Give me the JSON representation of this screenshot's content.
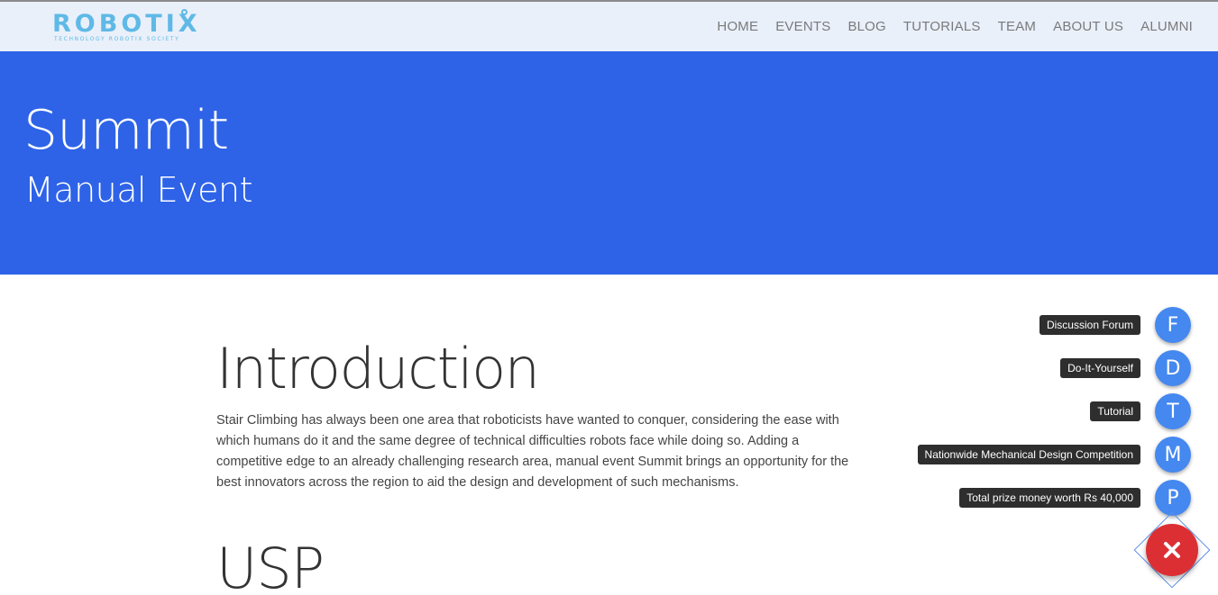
{
  "brand": {
    "logo_text": "ROBOTIX",
    "logo_tagline": "TECHNOLOGY ROBOTIX SOCIETY"
  },
  "nav": {
    "items": [
      {
        "label": "HOME"
      },
      {
        "label": "EVENTS"
      },
      {
        "label": "BLOG"
      },
      {
        "label": "TUTORIALS"
      },
      {
        "label": "TEAM"
      },
      {
        "label": "ABOUT US"
      },
      {
        "label": "ALUMNI"
      }
    ]
  },
  "hero": {
    "title": "Summit",
    "subtitle": "Manual Event"
  },
  "content": {
    "intro_heading": "Introduction",
    "intro_text": "Stair Climbing has always been one area that roboticists have wanted to conquer, considering the ease with which humans do it and the same degree of technical difficulties robots face while doing so. Adding a competitive edge to an already challenging research area, manual event Summit brings an opportunity for the best innovators across the region to aid the design and development of such mechanisms.",
    "usp_heading": "USP"
  },
  "fab_menu": {
    "items": [
      {
        "letter": "F",
        "label": "Discussion Forum"
      },
      {
        "letter": "D",
        "label": "Do-It-Yourself"
      },
      {
        "letter": "T",
        "label": "Tutorial"
      },
      {
        "letter": "M",
        "label": "Nationwide Mechanical Design Competition"
      },
      {
        "letter": "P",
        "label": "Total prize money worth Rs 40,000"
      }
    ],
    "close_icon": "close-icon"
  },
  "colors": {
    "hero_bg": "#2e63e8",
    "navbar_bg": "#e9f0fa",
    "fab_item": "#4488f0",
    "fab_main": "#dc2f34",
    "logo": "#5fb9e6"
  }
}
